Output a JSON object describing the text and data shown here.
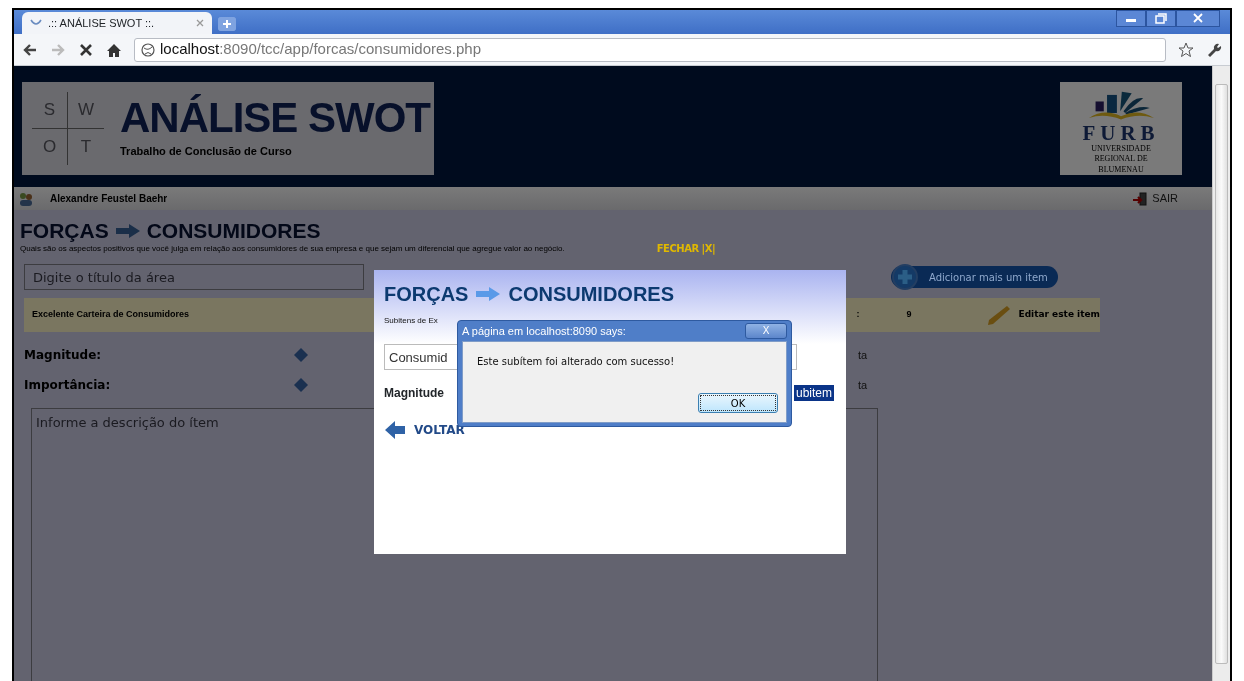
{
  "browser": {
    "tab_title": ".:: ANÁLISE SWOT ::.",
    "url_host": "localhost",
    "url_path": ":8090/tcc/app/forcas/consumidores.php"
  },
  "header": {
    "swot_letters": [
      "S",
      "W",
      "O",
      "T"
    ],
    "title": "ANÁLISE SWOT",
    "subtitle": "Trabalho de Conclusão de Curso",
    "logo_text": "FURB",
    "logo_caption": "UNIVERSIDADE REGIONAL DE BLUMENAU"
  },
  "user_bar": {
    "user": "Alexandre Feustel Baehr",
    "logout": "SAIR"
  },
  "page": {
    "title_left": "FORÇAS",
    "title_right": "CONSUMIDORES",
    "description": "Quais são os aspectos positivos que você julga em relação aos consumidores de sua empresa e que sejam um diferencial que agregue valor ao negócio.",
    "close": "FECHAR |X|",
    "area_placeholder": "Digite o título da área",
    "add_button": "Adicionar mais um item",
    "item": {
      "title": "Excelente Carteira de Consumidores",
      "colon": ":",
      "value": "9",
      "edit": "Editar este item"
    },
    "fields": [
      {
        "label": "Magnitude:",
        "trail": "ta"
      },
      {
        "label": "Importância:",
        "trail": "ta"
      }
    ],
    "description_placeholder": "Informe a descrição do ítem"
  },
  "modal": {
    "title_left": "FORÇAS",
    "title_right": "CONSUMIDORES",
    "subtitle": "Subitens de Ex",
    "input_value": "Consumid",
    "field_label": "Magnitude",
    "button": "ubitem",
    "back": "VOLTAR"
  },
  "alert": {
    "title": "A página em localhost:8090 says:",
    "close": "X",
    "message": "Este subítem foi alterado com sucesso!",
    "ok": "OK"
  }
}
